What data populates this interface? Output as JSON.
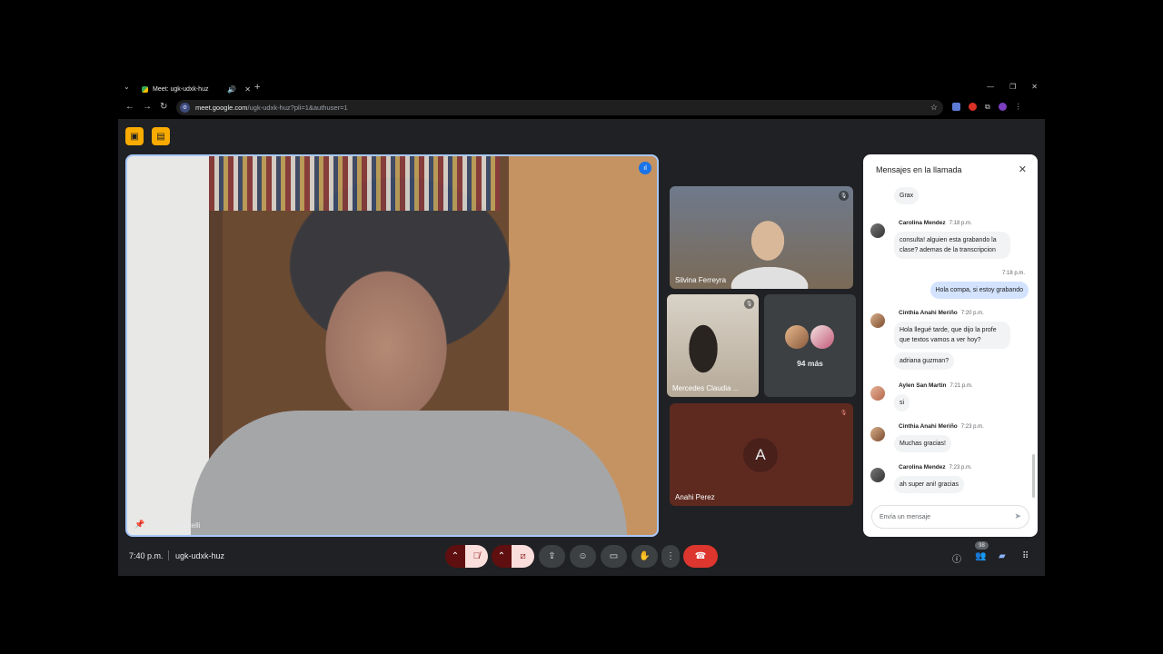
{
  "browser": {
    "tab_title": "Meet: ugk-udxk-huz",
    "url_host": "meet.google.com",
    "url_path": "/ugk-udxk-huz?pli=1&authuser=1"
  },
  "main_tile": {
    "name": "Carla Franquelli"
  },
  "tiles": [
    {
      "name": "Silvina Ferreyra"
    },
    {
      "name": "Mercedes Claudia ..."
    },
    {
      "label": "94 más"
    },
    {
      "initial": "A",
      "name": "Anahi Perez"
    }
  ],
  "chat": {
    "title": "Mensajes en la llamada",
    "placeholder": "Envía un mensaje",
    "messages": [
      {
        "text": "Grax"
      },
      {
        "sender": "Carolina Mendez",
        "time": "7:18 p.m.",
        "text": "consulta! alguien esta grabando la clase? ademas de la transcripcion"
      },
      {
        "time": "7:18 p.m.",
        "text": "Hola compa, si estoy grabando"
      },
      {
        "sender": "Cinthia Anahi Meriño",
        "time": "7:20 p.m.",
        "text": "Hola llegué tarde, que dijo la profe que textos vamos a ver hoy?"
      },
      {
        "text": "adriana guzman?"
      },
      {
        "sender": "Aylen San Martin",
        "time": "7:21 p.m.",
        "text": "si"
      },
      {
        "sender": "Cinthia Anahi Meriño",
        "time": "7:23 p.m.",
        "text": "Muchas gracias!"
      },
      {
        "sender": "Carolina Mendez",
        "time": "7:23 p.m.",
        "text": "ah super ani! gracias"
      }
    ]
  },
  "bottom": {
    "clock": "7:40 p.m.",
    "meeting_code": "ugk-udxk-huz",
    "participants_count": "98"
  },
  "colors": {
    "accent": "#a8c7fa",
    "end_call": "#dc362e",
    "warning_pill": "#f9ab00"
  }
}
